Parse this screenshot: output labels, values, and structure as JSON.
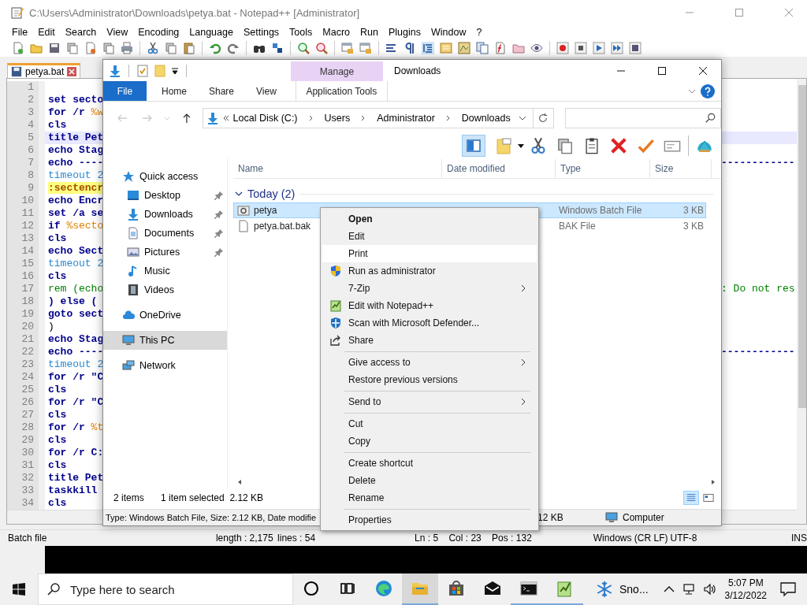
{
  "notepad": {
    "title": "C:\\Users\\Administrator\\Downloads\\petya.bat - Notepad++ [Administrator]",
    "menu": [
      "File",
      "Edit",
      "Search",
      "View",
      "Encoding",
      "Language",
      "Settings",
      "Tools",
      "Macro",
      "Run",
      "Plugins",
      "Window",
      "?"
    ],
    "tabs": [
      {
        "label": "petya.bat",
        "selected": true
      }
    ],
    "lines": [
      {
        "number": "1",
        "current": false
      },
      {
        "number": "2",
        "kind": "command",
        "text": "set secto",
        "current": false
      },
      {
        "number": "3",
        "kind": "command",
        "text": "for /r ",
        "variable": "%w",
        "current": false
      },
      {
        "number": "4",
        "kind": "command",
        "text": "cls",
        "current": false
      },
      {
        "number": "5",
        "kind": "command",
        "text": "title Pet",
        "current": true
      },
      {
        "number": "6",
        "kind": "command",
        "text": "echo Stag",
        "current": false
      },
      {
        "number": "7",
        "kind": "command",
        "text": "echo ----",
        "right": "------------",
        "current": false
      },
      {
        "number": "8",
        "kind": "timeout",
        "text": "timeout 2",
        "current": false
      },
      {
        "number": "9",
        "kind": "label",
        "text": ":sectencr",
        "current": false
      },
      {
        "number": "10",
        "kind": "command",
        "text": "echo Encr",
        "current": false
      },
      {
        "number": "11",
        "kind": "command",
        "text": "set /a se",
        "current": false
      },
      {
        "number": "12",
        "kind": "command",
        "text": "if ",
        "variable": "%secto",
        "current": false
      },
      {
        "number": "13",
        "kind": "command",
        "text": "cls",
        "current": false
      },
      {
        "number": "14",
        "kind": "command",
        "text": "echo Sect",
        "current": false
      },
      {
        "number": "15",
        "kind": "timeout",
        "text": "timeout 2",
        "current": false
      },
      {
        "number": "16",
        "kind": "command",
        "text": "cls",
        "current": false
      },
      {
        "number": "17",
        "kind": "comment",
        "text": "rem (echo",
        "right": ": Do not res",
        "current": false
      },
      {
        "number": "18",
        "kind": "command",
        "text": ") else (",
        "current": false
      },
      {
        "number": "19",
        "kind": "command",
        "text": "goto sect",
        "current": false
      },
      {
        "number": "20",
        "kind": "plain",
        "text": ")",
        "current": false
      },
      {
        "number": "21",
        "kind": "command",
        "text": "echo Stag",
        "current": false
      },
      {
        "number": "22",
        "kind": "command",
        "text": "echo ----",
        "right": "------------",
        "current": false
      },
      {
        "number": "23",
        "kind": "timeout",
        "text": "timeout 2",
        "current": false
      },
      {
        "number": "24",
        "kind": "command",
        "text": "for /r \"C",
        "current": false
      },
      {
        "number": "25",
        "kind": "command",
        "text": "cls",
        "current": false
      },
      {
        "number": "26",
        "kind": "command",
        "text": "for /r \"C",
        "current": false
      },
      {
        "number": "27",
        "kind": "command",
        "text": "cls",
        "current": false
      },
      {
        "number": "28",
        "kind": "command",
        "text": "for /r ",
        "variable": "%t",
        "current": false
      },
      {
        "number": "29",
        "kind": "command",
        "text": "cls",
        "current": false
      },
      {
        "number": "30",
        "kind": "command",
        "text": "for /r C:",
        "current": false
      },
      {
        "number": "31",
        "kind": "command",
        "text": "cls",
        "current": false
      },
      {
        "number": "32",
        "kind": "command",
        "text": "title Pet",
        "current": false
      },
      {
        "number": "33",
        "kind": "command",
        "text": "taskkill",
        "current": false
      },
      {
        "number": "34",
        "kind": "command",
        "text": "cls",
        "current": false
      }
    ],
    "status_bar": {
      "file_type": "Batch file",
      "length": "length : 2,175",
      "lines": "lines : 54",
      "position": "Ln : 5    Col : 23    Pos : 132",
      "eol": "Windows (CR LF)",
      "encoding": "UTF-8",
      "mode": "INS"
    }
  },
  "explorer": {
    "title": "Downloads",
    "contextual_group": "Manage",
    "ribbon_tabs": [
      {
        "label": "File",
        "kind": "file"
      },
      {
        "label": "Home",
        "kind": "tab"
      },
      {
        "label": "Share",
        "kind": "tab"
      },
      {
        "label": "View",
        "kind": "tab"
      },
      {
        "label": "Application Tools",
        "kind": "contextual"
      }
    ],
    "address": [
      "Local Disk (C:)",
      "Users",
      "Administrator",
      "Downloads"
    ],
    "nav": [
      {
        "label": "Quick access",
        "kind": "star",
        "selected": false,
        "children": [
          {
            "label": "Desktop",
            "kind": "desktop",
            "pinned": true,
            "selected": false
          },
          {
            "label": "Downloads",
            "kind": "download",
            "pinned": true,
            "selected": false
          },
          {
            "label": "Documents",
            "kind": "document",
            "pinned": true,
            "selected": false
          },
          {
            "label": "Pictures",
            "kind": "pictures",
            "pinned": true,
            "selected": false
          },
          {
            "label": "Music",
            "kind": "music",
            "pinned": false,
            "selected": false
          },
          {
            "label": "Videos",
            "kind": "video",
            "pinned": false,
            "selected": false
          }
        ]
      },
      {
        "label": "OneDrive",
        "kind": "cloud",
        "selected": false
      },
      {
        "label": "This PC",
        "kind": "computer",
        "selected": true
      },
      {
        "label": "Network",
        "kind": "network",
        "selected": false
      }
    ],
    "columns": [
      "Name",
      "Date modified",
      "Type",
      "Size"
    ],
    "group": "Today (2)",
    "files": [
      {
        "name": "petya",
        "kind": "batch",
        "type": "Windows Batch File",
        "size": "3 KB",
        "selected": true
      },
      {
        "name": "petya.bat.bak",
        "kind": "file",
        "type": "BAK File",
        "size": "3 KB",
        "selected": false
      }
    ],
    "status": {
      "count": "2 items",
      "selection": "1 item selected  2.12 KB"
    },
    "details_bar": {
      "text": "Type: Windows Batch File, Size: 2.12 KB, Date modifie",
      "size": "12 KB",
      "zone": "Computer"
    }
  },
  "context_menu": [
    {
      "kind": "item",
      "label": "Open",
      "default": true,
      "selected": false,
      "submenu": false
    },
    {
      "kind": "item",
      "label": "Edit",
      "default": false,
      "selected": false,
      "submenu": false
    },
    {
      "kind": "item",
      "label": "Print",
      "default": false,
      "selected": true,
      "submenu": false
    },
    {
      "kind": "admin",
      "label": "Run as administrator",
      "default": false,
      "selected": false,
      "submenu": false
    },
    {
      "kind": "item",
      "label": "7-Zip",
      "default": false,
      "selected": false,
      "submenu": true
    },
    {
      "kind": "app",
      "label": "Edit with Notepad++",
      "default": false,
      "selected": false,
      "submenu": false
    },
    {
      "kind": "scan",
      "label": "Scan with Microsoft Defender...",
      "default": false,
      "selected": false,
      "submenu": false
    },
    {
      "kind": "share",
      "label": "Share",
      "default": false,
      "selected": false,
      "submenu": false
    },
    {
      "kind": "separator"
    },
    {
      "kind": "item",
      "label": "Give access to",
      "default": false,
      "selected": false,
      "submenu": true
    },
    {
      "kind": "item",
      "label": "Restore previous versions",
      "default": false,
      "selected": false,
      "submenu": false
    },
    {
      "kind": "separator"
    },
    {
      "kind": "item",
      "label": "Send to",
      "default": false,
      "selected": false,
      "submenu": true
    },
    {
      "kind": "separator"
    },
    {
      "kind": "item",
      "label": "Cut",
      "default": false,
      "selected": false,
      "submenu": false
    },
    {
      "kind": "item",
      "label": "Copy",
      "default": false,
      "selected": false,
      "submenu": false
    },
    {
      "kind": "separator"
    },
    {
      "kind": "item",
      "label": "Create shortcut",
      "default": false,
      "selected": false,
      "submenu": false
    },
    {
      "kind": "item",
      "label": "Delete",
      "default": false,
      "selected": false,
      "submenu": false
    },
    {
      "kind": "item",
      "label": "Rename",
      "default": false,
      "selected": false,
      "submenu": false
    },
    {
      "kind": "separator"
    },
    {
      "kind": "item",
      "label": "Properties",
      "default": false,
      "selected": false,
      "submenu": false
    }
  ],
  "taskbar": {
    "search_placeholder": "Type here to search",
    "apps": [
      {
        "kind": "cortana",
        "running": false,
        "active": false
      },
      {
        "kind": "task-view",
        "running": false,
        "active": false
      },
      {
        "kind": "browser",
        "running": false,
        "active": false
      },
      {
        "kind": "explorer",
        "running": true,
        "active": true
      },
      {
        "kind": "store",
        "running": false,
        "active": false
      },
      {
        "kind": "mail",
        "running": false,
        "active": false
      },
      {
        "kind": "terminal",
        "running": true,
        "active": false
      },
      {
        "kind": "notepad",
        "running": true,
        "active": false
      }
    ],
    "weather": "Sno...",
    "time": "5:07 PM",
    "date": "3/12/2022"
  }
}
